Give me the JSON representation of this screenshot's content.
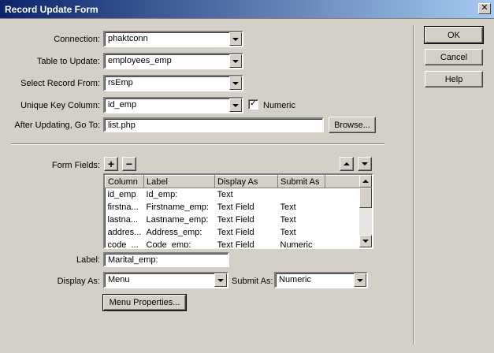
{
  "window": {
    "title": "Record Update Form",
    "close_glyph": "✕"
  },
  "form": {
    "connection_label": "Connection:",
    "connection_value": "phaktconn",
    "table_label": "Table to Update:",
    "table_value": "employees_emp",
    "select_record_label": "Select Record From:",
    "select_record_value": "rsEmp",
    "unique_key_label": "Unique Key Column:",
    "unique_key_value": "id_emp",
    "numeric_label": "Numeric",
    "numeric_checked": "✓",
    "after_label": "After Updating, Go To:",
    "after_value": "list.php",
    "browse_label": "Browse..."
  },
  "buttons": {
    "ok": "OK",
    "cancel": "Cancel",
    "help": "Help"
  },
  "form_fields": {
    "label": "Form Fields:",
    "add_glyph": "+",
    "remove_glyph": "−",
    "columns": [
      "Column",
      "Label",
      "Display As",
      "Submit As"
    ],
    "rows": [
      [
        "id_emp",
        "Id_emp:",
        "Text",
        ""
      ],
      [
        "firstna...",
        "Firstname_emp:",
        "Text Field",
        "Text"
      ],
      [
        "lastna...",
        "Lastname_emp:",
        "Text Field",
        "Text"
      ],
      [
        "addres...",
        "Address_emp:",
        "Text Field",
        "Text"
      ],
      [
        "code_...",
        "Code_emp:",
        "Text Field",
        "Numeric"
      ]
    ]
  },
  "detail": {
    "label_label": "Label:",
    "label_value": "Marital_emp:",
    "display_as_label": "Display As:",
    "display_as_value": "Menu",
    "submit_as_label": "Submit As:",
    "submit_as_value": "Numeric",
    "menu_properties": "Menu Properties..."
  }
}
